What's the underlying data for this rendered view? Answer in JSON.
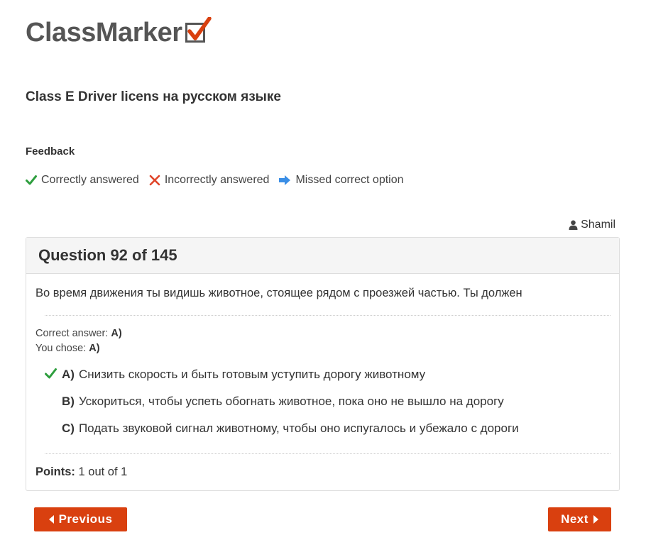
{
  "brand": {
    "name": "ClassMarker",
    "check_color": "#d9400f",
    "box_color": "#555555"
  },
  "quiz": {
    "title": "Class E Driver licens на русском языке"
  },
  "feedback": {
    "heading": "Feedback",
    "legend": [
      {
        "icon": "check-icon",
        "label": "Correctly answered",
        "color": "#2e9e3e"
      },
      {
        "icon": "cross-icon",
        "label": "Incorrectly answered",
        "color": "#e0452a"
      },
      {
        "icon": "arrow-right-icon",
        "label": "Missed correct option",
        "color": "#3a8ee6"
      }
    ]
  },
  "user": {
    "icon": "user-icon",
    "name": "Shamil"
  },
  "question": {
    "header": "Question 92 of 145",
    "text": "Во время движения ты видишь животное, стоящее рядом с проезжей частью. Ты должен",
    "correct_answer_label": "Correct answer:",
    "correct_answer_value": "A)",
    "you_chose_label": "You chose:",
    "you_chose_value": "A)",
    "options": [
      {
        "letter": "A)",
        "text": "Снизить скорость и быть готовым уступить дорогу животному",
        "status": "correct"
      },
      {
        "letter": "B)",
        "text": "Ускориться, чтобы успеть обогнать животное, пока оно не вышло на дорогу",
        "status": "none"
      },
      {
        "letter": "C)",
        "text": "Подать звуковой сигнал животному, чтобы оно испугалось и убежало с дороги",
        "status": "none"
      }
    ],
    "points_label": "Points:",
    "points_value": "1 out of 1"
  },
  "nav": {
    "previous_label": "Previous",
    "next_label": "Next",
    "button_color": "#d9400f"
  }
}
